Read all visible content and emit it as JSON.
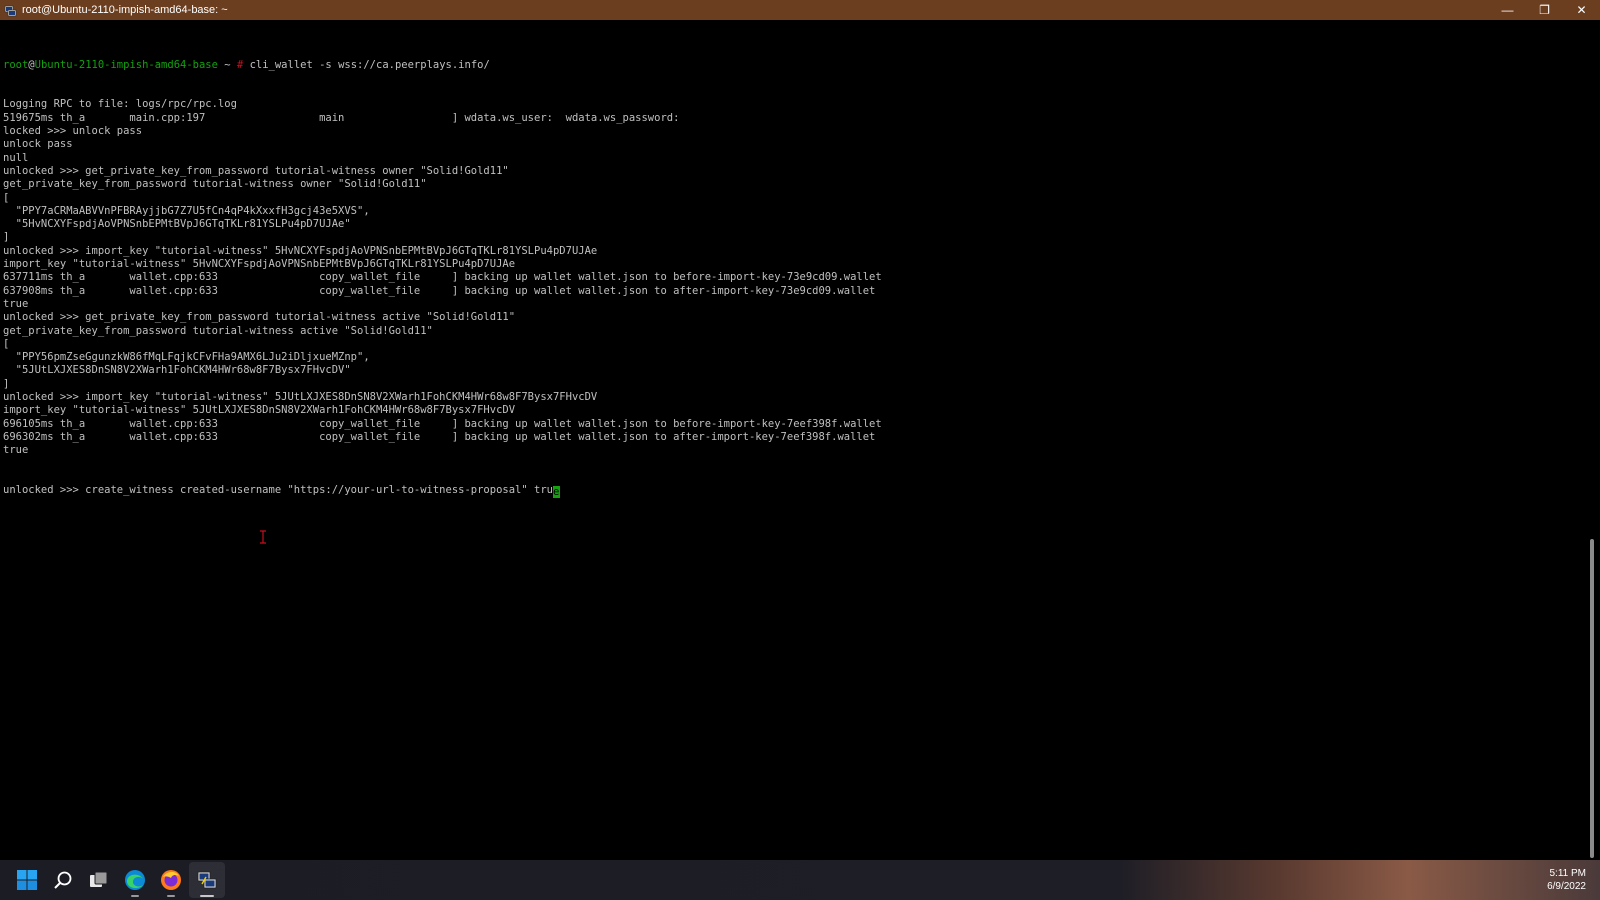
{
  "window": {
    "title": "root@Ubuntu-2110-impish-amd64-base: ~",
    "controls": {
      "minimize": "—",
      "maximize": "❐",
      "close": "✕"
    }
  },
  "prompt": {
    "user": "root",
    "at": "@",
    "host": "Ubuntu-2110-impish-amd64-base",
    "path": " ~ ",
    "symbol": "#"
  },
  "terminal": {
    "first_command": " cli_wallet -s wss://ca.peerplays.info/",
    "lines": [
      "Logging RPC to file: logs/rpc/rpc.log",
      "519675ms th_a       main.cpp:197                  main                 ] wdata.ws_user:  wdata.ws_password:",
      "locked >>> unlock pass",
      "unlock pass",
      "null",
      "unlocked >>> get_private_key_from_password tutorial-witness owner \"Solid!Gold11\"",
      "get_private_key_from_password tutorial-witness owner \"Solid!Gold11\"",
      "[",
      "  \"PPY7aCRMaABVVnPFBRAyjjbG7Z7U5fCn4qP4kXxxfH3gcj43e5XVS\",",
      "  \"5HvNCXYFspdjAoVPNSnbEPMtBVpJ6GTqTKLr81YSLPu4pD7UJAe\"",
      "]",
      "unlocked >>> import_key \"tutorial-witness\" 5HvNCXYFspdjAoVPNSnbEPMtBVpJ6GTqTKLr81YSLPu4pD7UJAe",
      "import_key \"tutorial-witness\" 5HvNCXYFspdjAoVPNSnbEPMtBVpJ6GTqTKLr81YSLPu4pD7UJAe",
      "637711ms th_a       wallet.cpp:633                copy_wallet_file     ] backing up wallet wallet.json to before-import-key-73e9cd09.wallet",
      "637908ms th_a       wallet.cpp:633                copy_wallet_file     ] backing up wallet wallet.json to after-import-key-73e9cd09.wallet",
      "true",
      "unlocked >>> get_private_key_from_password tutorial-witness active \"Solid!Gold11\"",
      "get_private_key_from_password tutorial-witness active \"Solid!Gold11\"",
      "[",
      "  \"PPY56pmZseGgunzkW86fMqLFqjkCFvFHa9AMX6LJu2iDljxueMZnp\",",
      "  \"5JUtLXJXES8DnSN8V2XWarh1FohCKM4HWr68w8F7Bysx7FHvcDV\"",
      "]",
      "unlocked >>> import_key \"tutorial-witness\" 5JUtLXJXES8DnSN8V2XWarh1FohCKM4HWr68w8F7Bysx7FHvcDV",
      "import_key \"tutorial-witness\" 5JUtLXJXES8DnSN8V2XWarh1FohCKM4HWr68w8F7Bysx7FHvcDV",
      "696105ms th_a       wallet.cpp:633                copy_wallet_file     ] backing up wallet wallet.json to before-import-key-7eef398f.wallet",
      "696302ms th_a       wallet.cpp:633                copy_wallet_file     ] backing up wallet wallet.json to after-import-key-7eef398f.wallet",
      "true"
    ],
    "current_input": "unlocked >>> create_witness created-username \"https://your-url-to-witness-proposal\" tru",
    "cursor_char": "e"
  },
  "taskbar": {
    "items": [
      {
        "icon": "windows-start-icon",
        "active": false
      },
      {
        "icon": "search-icon",
        "active": false
      },
      {
        "icon": "task-view-icon",
        "active": false
      },
      {
        "icon": "edge-browser-icon",
        "active": false
      },
      {
        "icon": "firefox-icon",
        "active": false
      },
      {
        "icon": "putty-terminal-icon",
        "active": true
      }
    ],
    "clock": {
      "time": "5:11 PM",
      "date": "6/9/2022"
    }
  },
  "colors": {
    "titlebar": "#6a3e1f",
    "terminal_bg": "#000000",
    "terminal_fg": "#c0c0c0",
    "prompt_green": "#13a10e",
    "prompt_red": "#c50f1f",
    "cursor": "#13a10e"
  },
  "scrollbar": {
    "position_fraction": 0.62,
    "visible_fraction": 0.38
  }
}
